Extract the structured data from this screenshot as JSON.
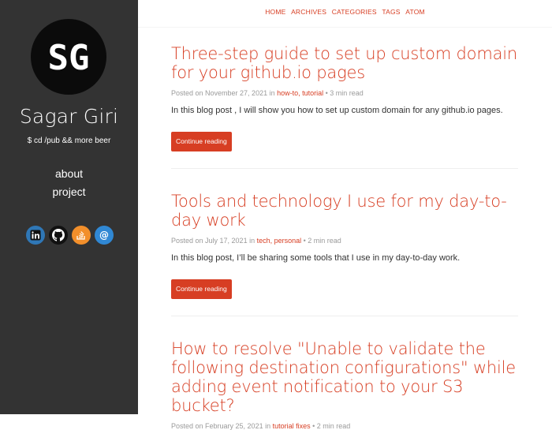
{
  "sidebar": {
    "avatar_text": "SG",
    "site_name": "Sagar Giri",
    "tagline": "$ cd /pub && more beer",
    "nav": [
      {
        "label": "about"
      },
      {
        "label": "project"
      }
    ],
    "social": [
      {
        "icon": "linkedin-icon",
        "color": "#2f77b6",
        "glyph": "in"
      },
      {
        "icon": "github-icon",
        "color": "#111111",
        "glyph": "gh"
      },
      {
        "icon": "stackoverflow-icon",
        "color": "#f28f2b",
        "glyph": "so"
      },
      {
        "icon": "mastodon-icon",
        "color": "#3088d4",
        "glyph": "@"
      }
    ]
  },
  "topnav": {
    "items": [
      "HOME",
      "ARCHIVES",
      "CATEGORIES",
      "TAGS",
      "ATOM"
    ]
  },
  "posts": [
    {
      "title": "Three-step guide to set up custom domain for your github.io pages",
      "posted_prefix": "Posted on ",
      "date": "November 27, 2021",
      "in": " in ",
      "categories": "how-to, tutorial",
      "read_time": " • 3 min read",
      "excerpt": "In this blog post , I will show you how to set up custom domain for any github.io pages.",
      "button": "Continue reading"
    },
    {
      "title": "Tools and technology I use for my day-to-day work",
      "posted_prefix": "Posted on ",
      "date": "July 17, 2021",
      "in": " in ",
      "categories": "tech, personal",
      "read_time": " • 2 min read",
      "excerpt": "In this blog post, I’ll be sharing some tools that I use in my day-to-day work.",
      "button": "Continue reading"
    },
    {
      "title": "How to resolve \"Unable to validate the following destination configurations\" while adding event notification to your S3 bucket?",
      "posted_prefix": "Posted on ",
      "date": "February 25, 2021",
      "in": " in ",
      "categories": "tutorial fixes",
      "read_time": " • 2 min read"
    }
  ],
  "colors": {
    "accent": "#d73e23",
    "sidebar_bg": "#333333",
    "meta_text": "#9a9a9a"
  }
}
